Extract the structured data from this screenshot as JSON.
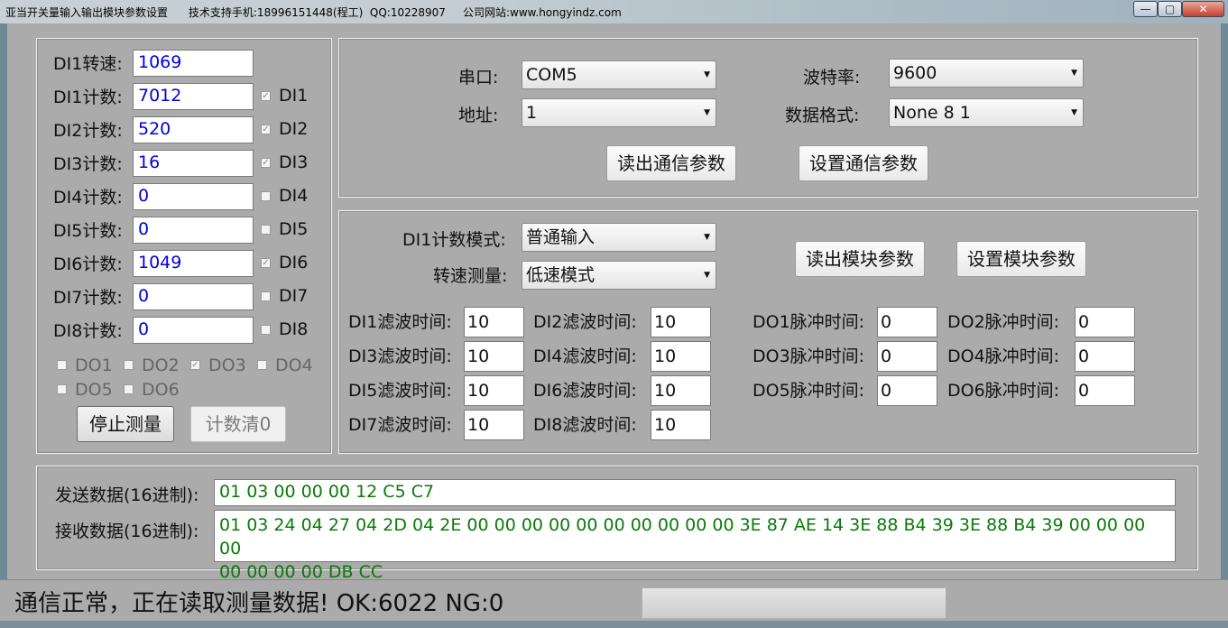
{
  "titlebar": {
    "title": "亚当开关量输入输出模块参数设置      技术支持手机:18996151448(程工)  QQ:10228907     公司网站:www.hongyindz.com",
    "min_glyph": "—",
    "max_glyph": "▢",
    "close_glyph": "✕"
  },
  "di_panel": {
    "speed": {
      "label": "DI1转速:",
      "value": "1069"
    },
    "counters": [
      {
        "label": "DI1计数:",
        "value": "7012",
        "check_label": "DI1",
        "checked": true
      },
      {
        "label": "DI2计数:",
        "value": "520",
        "check_label": "DI2",
        "checked": true
      },
      {
        "label": "DI3计数:",
        "value": "16",
        "check_label": "DI3",
        "checked": true
      },
      {
        "label": "DI4计数:",
        "value": "0",
        "check_label": "DI4",
        "checked": false
      },
      {
        "label": "DI5计数:",
        "value": "0",
        "check_label": "DI5",
        "checked": false
      },
      {
        "label": "DI6计数:",
        "value": "1049",
        "check_label": "DI6",
        "checked": true
      },
      {
        "label": "DI7计数:",
        "value": "0",
        "check_label": "DI7",
        "checked": false
      },
      {
        "label": "DI8计数:",
        "value": "0",
        "check_label": "DI8",
        "checked": false
      }
    ],
    "outputs": [
      {
        "label": "DO1",
        "checked": false
      },
      {
        "label": "DO2",
        "checked": false
      },
      {
        "label": "DO3",
        "checked": true
      },
      {
        "label": "DO4",
        "checked": false
      },
      {
        "label": "DO5",
        "checked": false
      },
      {
        "label": "DO6",
        "checked": false
      }
    ],
    "stop_button": "停止测量",
    "clear_button": "计数清0",
    "check_mark": "✓"
  },
  "comm": {
    "port_label": "串口:",
    "port_value": "COM5",
    "baud_label": "波特率:",
    "baud_value": "9600",
    "addr_label": "地址:",
    "addr_value": "1",
    "format_label": "数据格式:",
    "format_value": "None 8 1",
    "read_button": "读出通信参数",
    "set_button": "设置通信参数",
    "arrow": "▼"
  },
  "module": {
    "mode_label": "DI1计数模式:",
    "mode_value": "普通输入",
    "speed_label": "转速测量:",
    "speed_value": "低速模式",
    "read_button": "读出模块参数",
    "set_button": "设置模块参数",
    "filters": [
      {
        "label": "DI1滤波时间:",
        "value": "10"
      },
      {
        "label": "DI2滤波时间:",
        "value": "10"
      },
      {
        "label": "DI3滤波时间:",
        "value": "10"
      },
      {
        "label": "DI4滤波时间:",
        "value": "10"
      },
      {
        "label": "DI5滤波时间:",
        "value": "10"
      },
      {
        "label": "DI6滤波时间:",
        "value": "10"
      },
      {
        "label": "DI7滤波时间:",
        "value": "10"
      },
      {
        "label": "DI8滤波时间:",
        "value": "10"
      }
    ],
    "pulses": [
      {
        "label": "DO1脉冲时间:",
        "value": "0"
      },
      {
        "label": "DO2脉冲时间:",
        "value": "0"
      },
      {
        "label": "DO3脉冲时间:",
        "value": "0"
      },
      {
        "label": "DO4脉冲时间:",
        "value": "0"
      },
      {
        "label": "DO5脉冲时间:",
        "value": "0"
      },
      {
        "label": "DO6脉冲时间:",
        "value": "0"
      }
    ]
  },
  "data": {
    "send_label": "发送数据(16进制):",
    "send_value": "01 03 00 00 00 12 C5 C7",
    "recv_label": "接收数据(16进制):",
    "recv_line1": "01 03 24 04 27 04 2D 04 2E 00 00 00 00 00 00 00 00 00 00 3E 87 AE 14 3E 88 B4 39 3E 88 B4 39 00 00 00 00",
    "recv_line2": "00 00 00 00 DB CC"
  },
  "status": {
    "text": "通信正常，正在读取测量数据!  OK:6022  NG:0",
    "progress": 0
  }
}
